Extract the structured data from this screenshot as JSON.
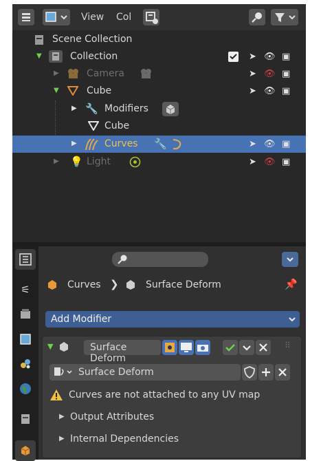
{
  "outliner": {
    "header": {
      "view_label": "View",
      "col_label": "Col"
    },
    "rows": [
      {
        "label": "Scene Collection"
      },
      {
        "label": "Collection"
      },
      {
        "label": "Camera"
      },
      {
        "label": "Cube"
      },
      {
        "label": "Modifiers"
      },
      {
        "label": "Cube"
      },
      {
        "label": "Curves"
      },
      {
        "label": "Light"
      }
    ]
  },
  "properties": {
    "breadcrumb": {
      "object": "Curves",
      "modifier": "Surface Deform"
    },
    "add_modifier": "Add Modifier",
    "modifier_panel": {
      "name": "Surface Deform",
      "target": "Surface Deform",
      "warning": "Curves are not attached to any UV map",
      "sections": [
        "Output Attributes",
        "Internal Dependencies"
      ]
    }
  },
  "colors": {
    "accent": "#4772b3",
    "background": "#303030",
    "panel": "#3d3d3d"
  }
}
